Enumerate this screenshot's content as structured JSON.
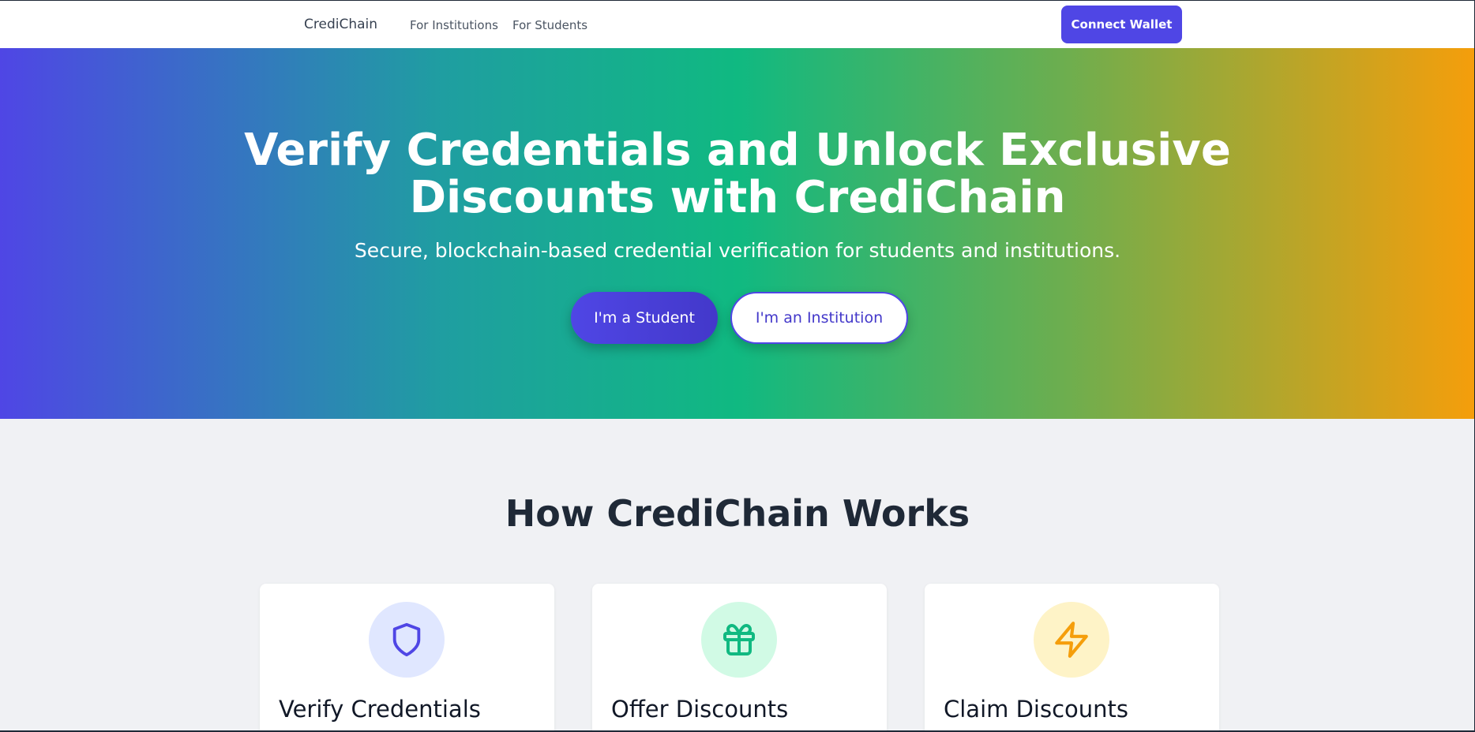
{
  "nav": {
    "brand": "CrediChain",
    "links": [
      "For Institutions",
      "For Students"
    ],
    "connect_label": "Connect Wallet"
  },
  "hero": {
    "title_line1": "Verify Credentials and Unlock Exclusive",
    "title_line2": "Discounts with CrediChain",
    "subtitle": "Secure, blockchain-based credential verification for students and institutions.",
    "student_button": "I'm a Student",
    "institution_button": "I'm an Institution"
  },
  "how": {
    "title": "How CrediChain Works",
    "cards": [
      {
        "title": "Verify Credentials",
        "icon": "shield-icon",
        "color": "#4f46e5"
      },
      {
        "title": "Offer Discounts",
        "icon": "gift-icon",
        "color": "#10b981"
      },
      {
        "title": "Claim Discounts",
        "icon": "lightning-icon",
        "color": "#f59e0b"
      }
    ]
  },
  "colors": {
    "primary": "#4f46e5",
    "green": "#10b981",
    "amber": "#f59e0b"
  }
}
